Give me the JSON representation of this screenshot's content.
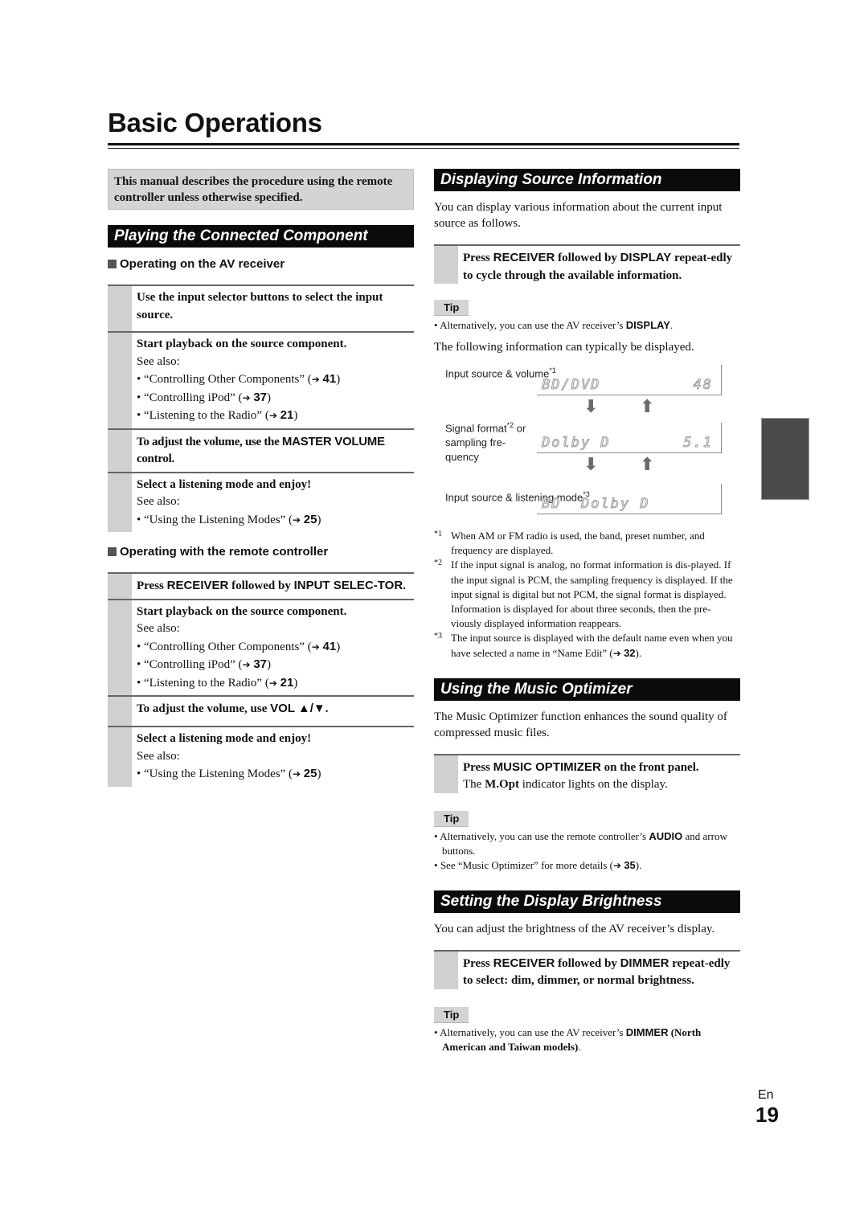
{
  "page": {
    "title": "Basic Operations",
    "language": "En",
    "page_number": "19"
  },
  "left": {
    "note": "This manual describes the procedure using the remote controller unless otherwise specified.",
    "section_title": "Playing the Connected Component",
    "av_receiver": {
      "heading": "Operating on the AV receiver",
      "steps": [
        {
          "title": "Use the input selector buttons to select the input source."
        },
        {
          "title": "Start playback on the source component.",
          "see_also": "See also:",
          "bullets": [
            {
              "text": "“Controlling Other Components” (",
              "ref": "41"
            },
            {
              "text": "“Controlling iPod” (",
              "ref": "37"
            },
            {
              "text": "“Listening to the Radio” (",
              "ref": "21"
            }
          ]
        },
        {
          "title_pre": "To adjust the volume, use the ",
          "title_key": "MASTER VOLUME",
          "title_post": " control."
        },
        {
          "title": "Select a listening mode and enjoy!",
          "see_also": "See also:",
          "bullets": [
            {
              "text": "“Using the Listening Modes” (",
              "ref": "25"
            }
          ]
        }
      ]
    },
    "remote": {
      "heading": "Operating with the remote controller",
      "steps": [
        {
          "title_pre": "Press ",
          "key1": "RECEIVER",
          "mid": " followed by ",
          "key2": "INPUT SELEC-TOR",
          "post": "."
        },
        {
          "title": "Start playback on the source component.",
          "see_also": "See also:",
          "bullets": [
            {
              "text": "“Controlling Other Components” (",
              "ref": "41"
            },
            {
              "text": "“Controlling iPod” (",
              "ref": "37"
            },
            {
              "text": "“Listening to the Radio” (",
              "ref": "21"
            }
          ]
        },
        {
          "title_pre": "To adjust the volume, use ",
          "title_key": "VOL ▲/▼",
          "title_post": "."
        },
        {
          "title": "Select a listening mode and enjoy!",
          "see_also": "See also:",
          "bullets": [
            {
              "text": "“Using the Listening Modes” (",
              "ref": "25"
            }
          ]
        }
      ]
    }
  },
  "right": {
    "display_info": {
      "section_title": "Displaying Source Information",
      "intro": "You can display various information about the current input source as follows.",
      "step": {
        "pre": "Press ",
        "key1": "RECEIVER",
        "mid": " followed by ",
        "key2": "DISPLAY",
        "post": " repeat-edly to cycle through the available information."
      },
      "tip_label": "Tip",
      "tip": {
        "pre": "Alternatively, you can use the AV receiver’s ",
        "key": "DISPLAY",
        "post": "."
      },
      "following": "The following information can typically be displayed.",
      "displays": [
        {
          "label": "Input source & volume",
          "mark": "*1",
          "left": "BD/DVD",
          "right": "48"
        },
        {
          "label": "Signal format",
          "mark": "*2",
          "label2": " or sampling fre-quency",
          "left": "Dolby D",
          "right": "5.1"
        },
        {
          "label": "Input source & listening mode",
          "mark": "*3",
          "left": "BD  Dolby D",
          "right": ""
        }
      ],
      "footnotes": [
        {
          "mark": "*1",
          "text": "When AM or FM radio is used, the band, preset number, and frequency are displayed."
        },
        {
          "mark": "*2",
          "text": "If the input signal is analog, no format information is dis-played. If the input signal is PCM, the sampling frequency is displayed. If the input signal is digital but not PCM, the signal format is displayed.",
          "text2": "Information is displayed for about three seconds, then the pre-viously displayed information reappears."
        },
        {
          "mark": "*3",
          "text": "The input source is displayed with the default name even when you have selected a name in “Name Edit” (",
          "ref": "32",
          "post": ")."
        }
      ]
    },
    "music_optimizer": {
      "section_title": "Using the Music Optimizer",
      "intro": "The Music Optimizer function enhances the sound quality of compressed music files.",
      "step": {
        "pre": "Press ",
        "key": "MUSIC OPTIMIZER",
        "post": " on the front panel.",
        "sub_pre": "The ",
        "sub_key": "M.Opt",
        "sub_post": " indicator lights on the display."
      },
      "tip_label": "Tip",
      "tips": [
        {
          "pre": "Alternatively, you can use the remote controller’s ",
          "key": "AUDIO",
          "post": " and arrow buttons."
        },
        {
          "pre": "See “Music Optimizer” for more details (",
          "ref": "35",
          "post": ")."
        }
      ]
    },
    "brightness": {
      "section_title": "Setting the Display Brightness",
      "intro": "You can adjust the brightness of the AV receiver’s display.",
      "step": {
        "pre": "Press ",
        "key1": "RECEIVER",
        "mid": " followed by ",
        "key2": "DIMMER",
        "post": " repeat-edly to select: dim, dimmer, or normal brightness."
      },
      "tip_label": "Tip",
      "tip": {
        "pre": "Alternatively, you can use the AV receiver’s ",
        "key": "DIMMER",
        "post_bold": " (North American and Taiwan models)",
        "post": "."
      }
    }
  }
}
